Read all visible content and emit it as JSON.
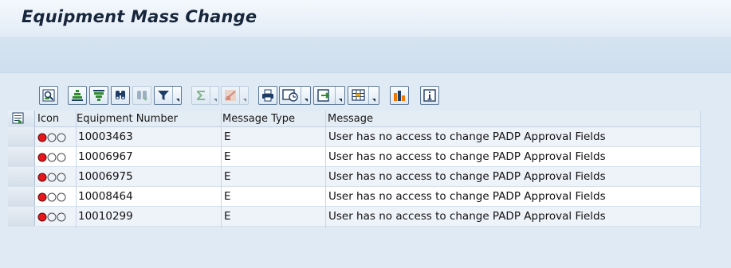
{
  "window": {
    "title": "Equipment Mass Change"
  },
  "toolbar": {
    "buttons": [
      {
        "name": "details-icon"
      },
      {
        "name": "sort-ascending-icon"
      },
      {
        "name": "sort-descending-icon"
      },
      {
        "name": "find-icon"
      },
      {
        "name": "find-next-icon"
      },
      {
        "name": "filter-icon"
      },
      {
        "name": "total-icon"
      },
      {
        "name": "subtotal-icon"
      },
      {
        "name": "print-preview-icon"
      },
      {
        "name": "views-icon"
      },
      {
        "name": "export-icon"
      },
      {
        "name": "layout-icon"
      },
      {
        "name": "graphic-icon"
      },
      {
        "name": "info-icon"
      }
    ]
  },
  "grid": {
    "columns": [
      "Icon",
      "Equipment Number",
      "Message Type",
      "Message"
    ],
    "rows": [
      {
        "status": "red",
        "equipment": "10003463",
        "type": "E",
        "message": "User has no access to change PADP Approval Fields"
      },
      {
        "status": "red",
        "equipment": "10006967",
        "type": "E",
        "message": "User has no access to change PADP Approval Fields"
      },
      {
        "status": "red",
        "equipment": "10006975",
        "type": "E",
        "message": "User has no access to change PADP Approval Fields"
      },
      {
        "status": "red",
        "equipment": "10008464",
        "type": "E",
        "message": "User has no access to change PADP Approval Fields"
      },
      {
        "status": "red",
        "equipment": "10010299",
        "type": "E",
        "message": "User has no access to change PADP Approval Fields"
      }
    ]
  },
  "colors": {
    "background": "#dfeaf5",
    "title_text": "#17263a",
    "error_light": "#e8161b",
    "row_alt": "#eef3f9"
  }
}
